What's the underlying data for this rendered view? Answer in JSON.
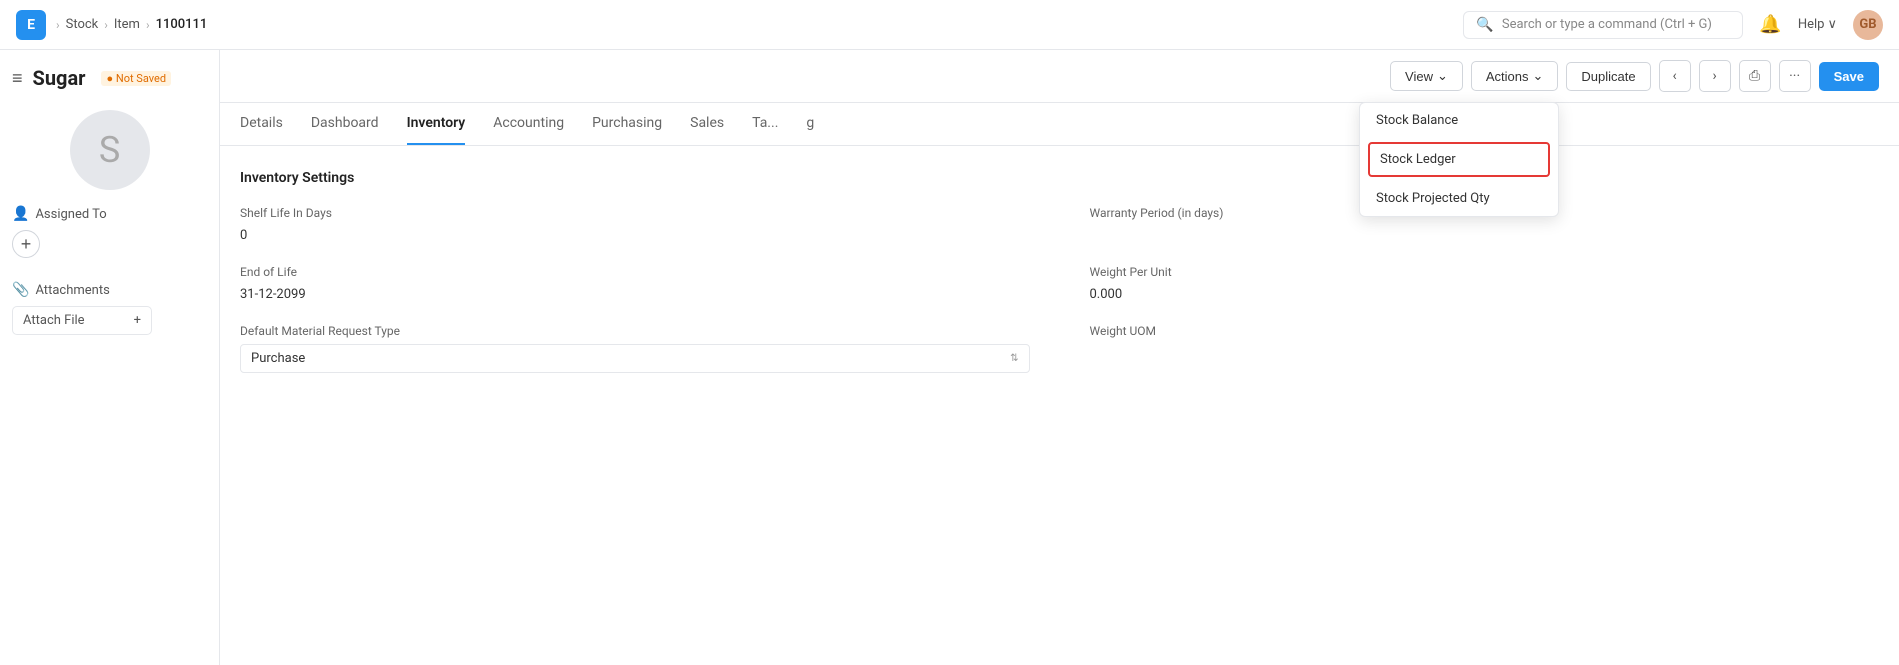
{
  "app": {
    "icon": "E",
    "icon_bg": "#2490ef"
  },
  "breadcrumb": {
    "items": [
      "Stock",
      "Item",
      "1100111"
    ]
  },
  "search": {
    "placeholder": "Search or type a command (Ctrl + G)"
  },
  "help": {
    "label": "Help"
  },
  "user": {
    "initials": "GB"
  },
  "sidebar": {
    "hamburger": "≡",
    "title": "Sugar",
    "not_saved": "● Not Saved",
    "assigned_to_label": "Assigned To",
    "add_btn": "+",
    "attachments_label": "Attachments",
    "attach_file_label": "Attach File",
    "attach_plus": "+"
  },
  "toolbar": {
    "view_label": "View",
    "actions_label": "Actions",
    "duplicate_label": "Duplicate",
    "save_label": "Save",
    "prev_icon": "‹",
    "next_icon": "›",
    "print_icon": "⎙",
    "more_icon": "···"
  },
  "actions_dropdown": {
    "items": [
      {
        "label": "Stock Balance",
        "highlighted": false
      },
      {
        "label": "Stock Ledger",
        "highlighted": true
      },
      {
        "label": "Stock Projected Qty",
        "highlighted": false
      }
    ]
  },
  "tabs": [
    {
      "label": "Details",
      "active": false
    },
    {
      "label": "Dashboard",
      "active": false
    },
    {
      "label": "Inventory",
      "active": true
    },
    {
      "label": "Accounting",
      "active": false
    },
    {
      "label": "Purchasing",
      "active": false
    },
    {
      "label": "Sales",
      "active": false
    },
    {
      "label": "Ta...",
      "active": false
    },
    {
      "label": "g",
      "active": false
    }
  ],
  "form": {
    "section_title": "Inventory Settings",
    "fields": [
      {
        "label": "Shelf Life In Days",
        "value": "0",
        "type": "static"
      },
      {
        "label": "Warranty Period (in days)",
        "value": "",
        "type": "static"
      },
      {
        "label": "End of Life",
        "value": "31-12-2099",
        "type": "static"
      },
      {
        "label": "Weight Per Unit",
        "value": "0.000",
        "type": "static"
      },
      {
        "label": "Default Material Request Type",
        "value": "Purchase",
        "type": "select"
      },
      {
        "label": "Weight UOM",
        "value": "",
        "type": "static"
      }
    ]
  }
}
